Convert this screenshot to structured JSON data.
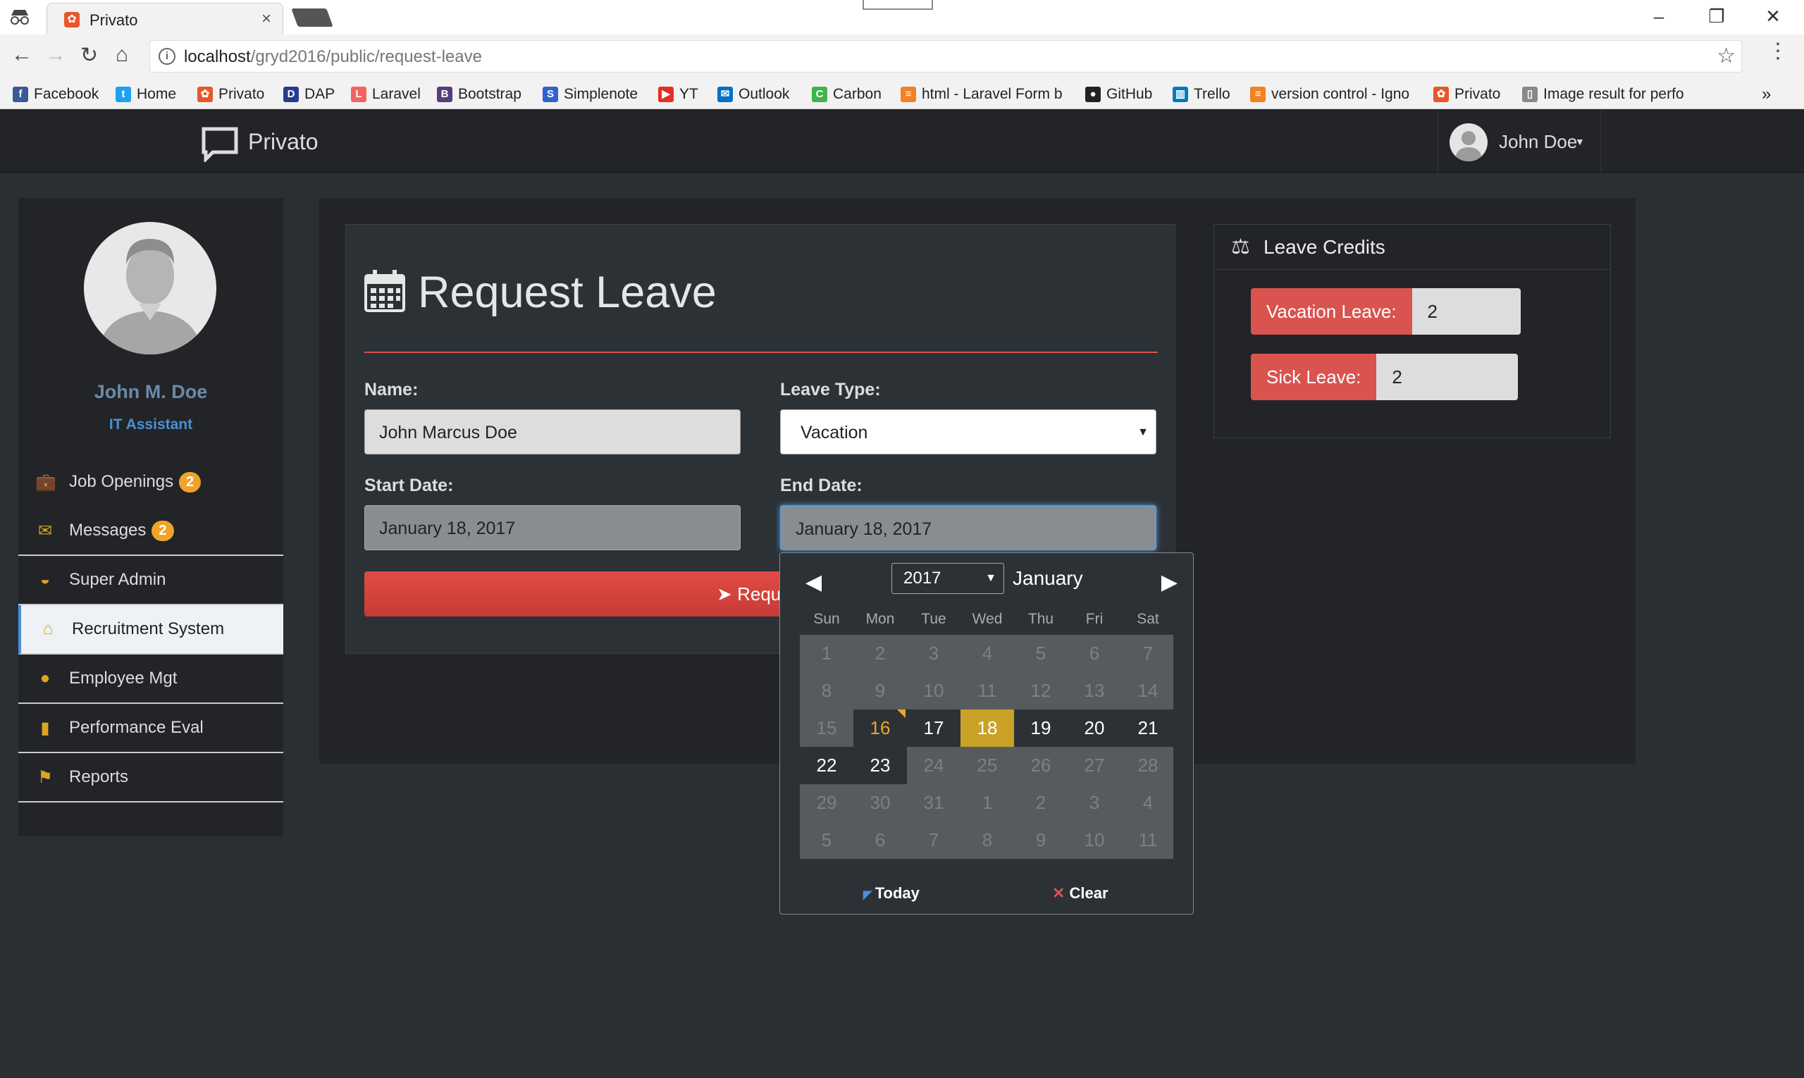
{
  "browser": {
    "tab_title": "Privato",
    "tab_close": "×",
    "url_host": "localhost",
    "url_path": "/gryd2016/public/request-leave",
    "minimize": "–",
    "restore": "❐",
    "close": "✕",
    "bookmarks": [
      {
        "label": "Facebook",
        "icon": "f",
        "color": "#3b5998"
      },
      {
        "label": "Home",
        "icon": "t",
        "color": "#1da1f2"
      },
      {
        "label": "Privato",
        "icon": "✿",
        "color": "#e8562a"
      },
      {
        "label": "DAP",
        "icon": "D",
        "color": "#2a3a8f"
      },
      {
        "label": "Laravel",
        "icon": "L",
        "color": "#f4645f"
      },
      {
        "label": "Bootstrap",
        "icon": "B",
        "color": "#563d7c"
      },
      {
        "label": "Simplenote",
        "icon": "S",
        "color": "#3361cc"
      },
      {
        "label": "YT",
        "icon": "▶",
        "color": "#e52d27"
      },
      {
        "label": "Outlook",
        "icon": "✉",
        "color": "#0072c6"
      },
      {
        "label": "Carbon",
        "icon": "C",
        "color": "#3db54a"
      },
      {
        "label": "html - Laravel Form b",
        "icon": "≡",
        "color": "#f48024"
      },
      {
        "label": "GitHub",
        "icon": "●",
        "color": "#222222"
      },
      {
        "label": "Trello",
        "icon": "▥",
        "color": "#0079bf"
      },
      {
        "label": "version control - Igno",
        "icon": "≡",
        "color": "#f48024"
      },
      {
        "label": "Privato",
        "icon": "✿",
        "color": "#e8562a"
      },
      {
        "label": "Image result for perfo",
        "icon": "▯",
        "color": "#888888"
      }
    ],
    "more": "»"
  },
  "app": {
    "brand": "Privato",
    "user_name": "John Doe"
  },
  "sidebar": {
    "name": "John M. Doe",
    "role": "IT Assistant",
    "items": [
      {
        "label": "Job Openings",
        "badge": "2",
        "icon": "briefcase-icon"
      },
      {
        "label": "Messages",
        "badge": "2",
        "icon": "envelope-icon"
      },
      {
        "label": "Super Admin",
        "badge": "",
        "icon": "sunglasses-icon"
      },
      {
        "label": "Recruitment System",
        "badge": "",
        "icon": "home-icon",
        "active": true
      },
      {
        "label": "Employee Mgt",
        "badge": "",
        "icon": "user-icon"
      },
      {
        "label": "Performance Eval",
        "badge": "",
        "icon": "bar-chart-icon"
      },
      {
        "label": "Reports",
        "badge": "",
        "icon": "flag-icon"
      }
    ]
  },
  "form": {
    "title": "Request Leave",
    "name_label": "Name:",
    "name_value": "John Marcus Doe",
    "leave_type_label": "Leave Type:",
    "leave_type_value": "Vacation",
    "start_label": "Start Date:",
    "start_value": "January 18, 2017",
    "end_label": "End Date:",
    "end_value": "January 18, 2017",
    "submit_label": "Request"
  },
  "credits": {
    "title": "Leave Credits",
    "vacation_label": "Vacation Leave:",
    "vacation_value": "2",
    "sick_label": "Sick Leave:",
    "sick_value": "2"
  },
  "datepicker": {
    "year": "2017",
    "month": "January",
    "dow": [
      "Sun",
      "Mon",
      "Tue",
      "Wed",
      "Thu",
      "Fri",
      "Sat"
    ],
    "weeks": [
      [
        "1",
        "2",
        "3",
        "4",
        "5",
        "6",
        "7"
      ],
      [
        "8",
        "9",
        "10",
        "11",
        "12",
        "13",
        "14"
      ],
      [
        "15",
        "16",
        "17",
        "18",
        "19",
        "20",
        "21"
      ],
      [
        "22",
        "23",
        "24",
        "25",
        "26",
        "27",
        "28"
      ],
      [
        "29",
        "30",
        "31",
        "1",
        "2",
        "3",
        "4"
      ],
      [
        "5",
        "6",
        "7",
        "8",
        "9",
        "10",
        "11"
      ]
    ],
    "enabled": [
      "16",
      "17",
      "18",
      "19",
      "20",
      "21",
      "22",
      "23"
    ],
    "today": "16",
    "selected": "18",
    "today_label": "Today",
    "clear_label": "Clear"
  },
  "colors": {
    "accent_red": "#d9534f",
    "badge_orange": "#f0a32a",
    "selected_gold": "#c9a227",
    "link_blue": "#4a90d9"
  }
}
